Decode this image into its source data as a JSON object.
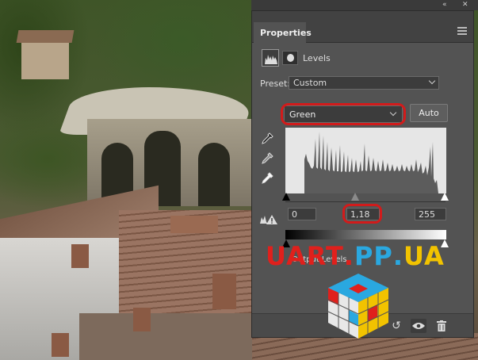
{
  "panel": {
    "title": "Properties",
    "adjustment_title": "Levels",
    "preset_label": "Preset:",
    "preset_value": "Custom",
    "channel_value": "Green",
    "auto_label": "Auto",
    "input_levels": {
      "black": "0",
      "gamma": "1,18",
      "white": "255"
    },
    "output_label": "Output Levels",
    "icons": {
      "levels_adjustment": "levels-histogram-icon",
      "layer_mask": "mask-icon",
      "black_point": "eyedropper-black-icon",
      "gray_point": "eyedropper-gray-icon",
      "white_point": "eyedropper-white-icon",
      "clipping": "clipping-warning-icon",
      "reset": "reset-icon",
      "visibility": "eye-icon",
      "delete": "trash-icon",
      "panel_menu": "hamburger-menu-icon",
      "collapse": "double-chevron-icon",
      "close": "close-icon"
    }
  },
  "watermark": {
    "text_parts": [
      {
        "text": "UART",
        "color": "#e0201c"
      },
      {
        "text": ".",
        "color": "#e0201c"
      },
      {
        "text": "PP",
        "color": "#2aa8e0"
      },
      {
        "text": ".",
        "color": "#2aa8e0"
      },
      {
        "text": "UA",
        "color": "#f2c300"
      }
    ]
  },
  "colors": {
    "panel_bg": "#535353",
    "highlight_red": "#d21b1b",
    "histogram_bg": "#e6e6e6"
  }
}
